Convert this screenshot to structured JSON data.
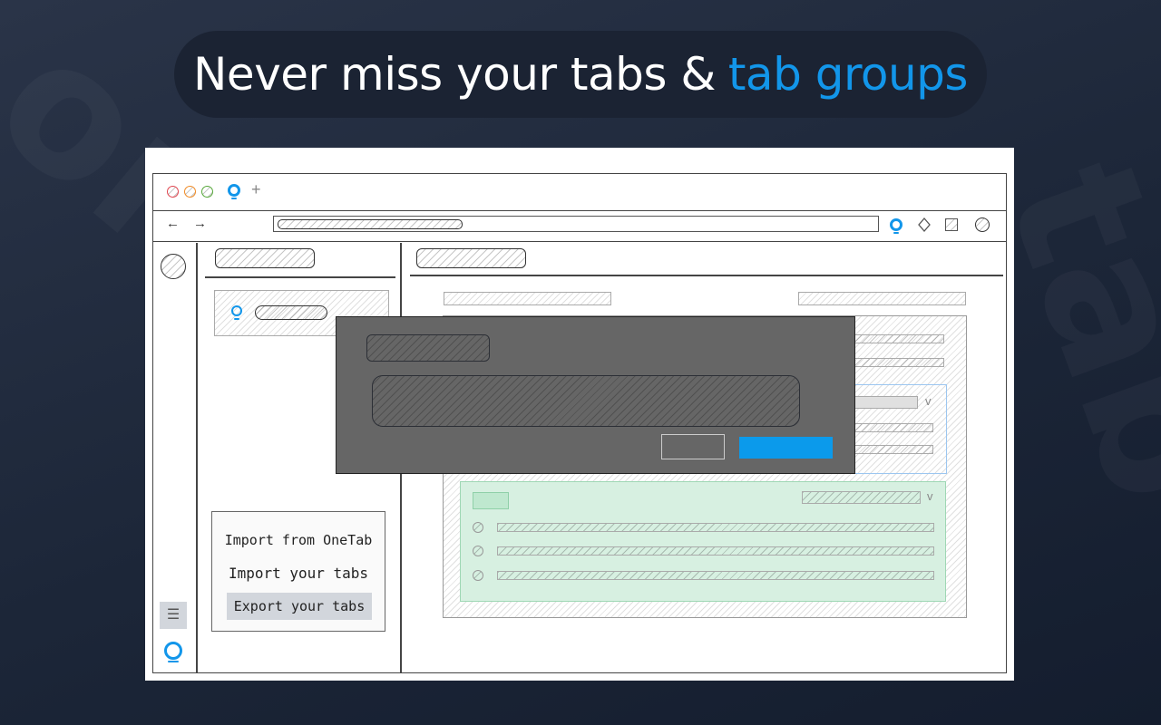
{
  "headline": {
    "text": "Never miss your tabs &",
    "accent": "tab groups"
  },
  "colors": {
    "accent": "#1296ea",
    "background": "#1c2638",
    "modal": "#666666",
    "group_green": "#d7f0e1",
    "group_blue": "#9cc6f0"
  },
  "browser": {
    "window_controls": [
      "close-dot-red",
      "minimize-dot-orange",
      "maximize-dot-green"
    ],
    "new_tab": "+",
    "nav": {
      "back": "←",
      "forward": "→"
    },
    "toolbar_icons": [
      "app-logo-icon",
      "diamond-icon",
      "square-icon",
      "circle-icon"
    ]
  },
  "sidebar_menu": {
    "items": [
      {
        "label": "Import from OneTab",
        "selected": false
      },
      {
        "label": "Import your tabs",
        "selected": false
      },
      {
        "label": "Export your tabs",
        "selected": true
      }
    ],
    "menu_icon": "☰"
  },
  "modal": {
    "cancel_label": "",
    "confirm_label": ""
  }
}
